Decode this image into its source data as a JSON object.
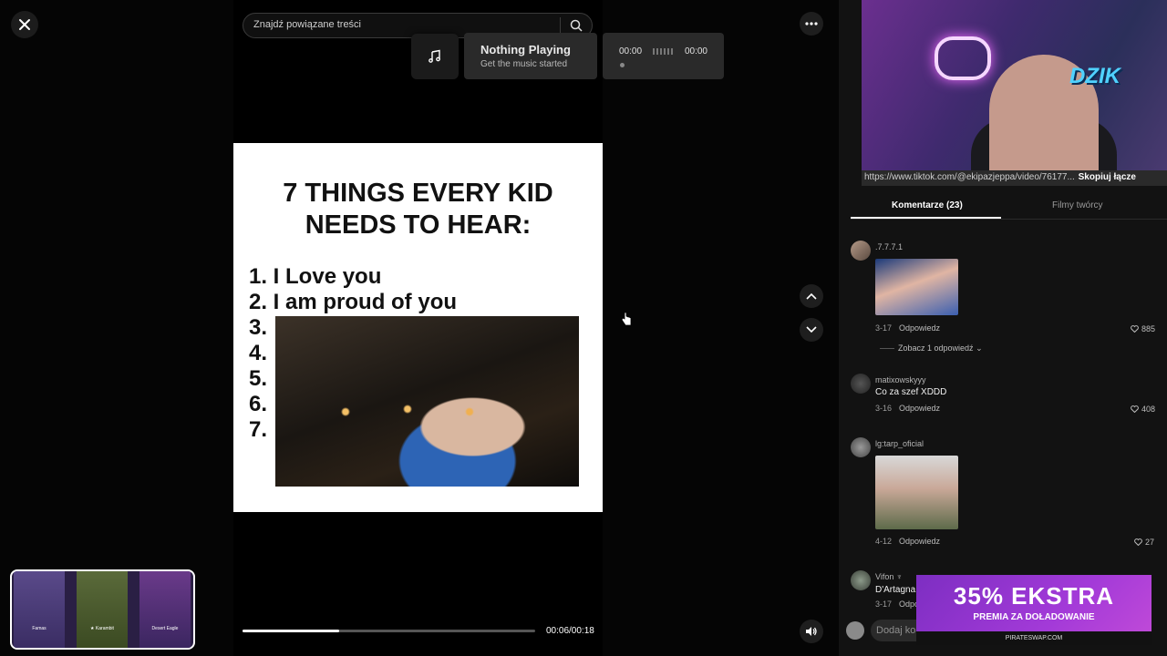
{
  "search": {
    "placeholder": "Znajdź powiązane treści"
  },
  "music": {
    "title": "Nothing Playing",
    "subtitle": "Get the music started",
    "time_current": "00:00",
    "time_total": "00:00"
  },
  "video": {
    "heading_line1": "7 THINGS EVERY KID",
    "heading_line2": "NEEDS TO HEAR:",
    "list": [
      "1. I Love you",
      "2. I am proud of you",
      "3.",
      "4.",
      "5.",
      "6.",
      "7."
    ],
    "time": "00:06/00:18",
    "progress": 0.33
  },
  "stream": {
    "link": "https://www.tiktok.com/@ekipazjeppa/video/76177...",
    "copy_label": "Skopiuj łącze",
    "logo": "DZIK"
  },
  "tabs": {
    "comments": "Komentarze (23)",
    "creator": "Filmy twórcy"
  },
  "comments": [
    {
      "user": ".7.7.7.1",
      "text": "",
      "date": "3-17",
      "reply": "Odpowiedz",
      "likes": "885",
      "view_replies": "Zobacz 1 odpowiedź"
    },
    {
      "user": "matixowskyyy",
      "text": "Co za szef XDDD",
      "date": "3-16",
      "reply": "Odpowiedz",
      "likes": "408"
    },
    {
      "user": "lg:tarp_oficial",
      "text": "",
      "date": "4-12",
      "reply": "Odpowiedz",
      "likes": "27"
    },
    {
      "user": "Vifon ♆",
      "text": "D'Artagna",
      "date": "3-17",
      "reply": "Odpo"
    }
  ],
  "input": {
    "placeholder": "Dodaj ko"
  },
  "ad": {
    "headline": "35% EKSTRA",
    "subline": "PREMIA ZA DOŁADOWANIE",
    "url": "PIRATESWAP.COM"
  },
  "case": {
    "items": [
      "Famas",
      "★ Karambit",
      "Desert Eagle"
    ]
  },
  "colors": {
    "accent": "#ffffff",
    "panel": "#121212",
    "ad": "#a33ad8"
  }
}
